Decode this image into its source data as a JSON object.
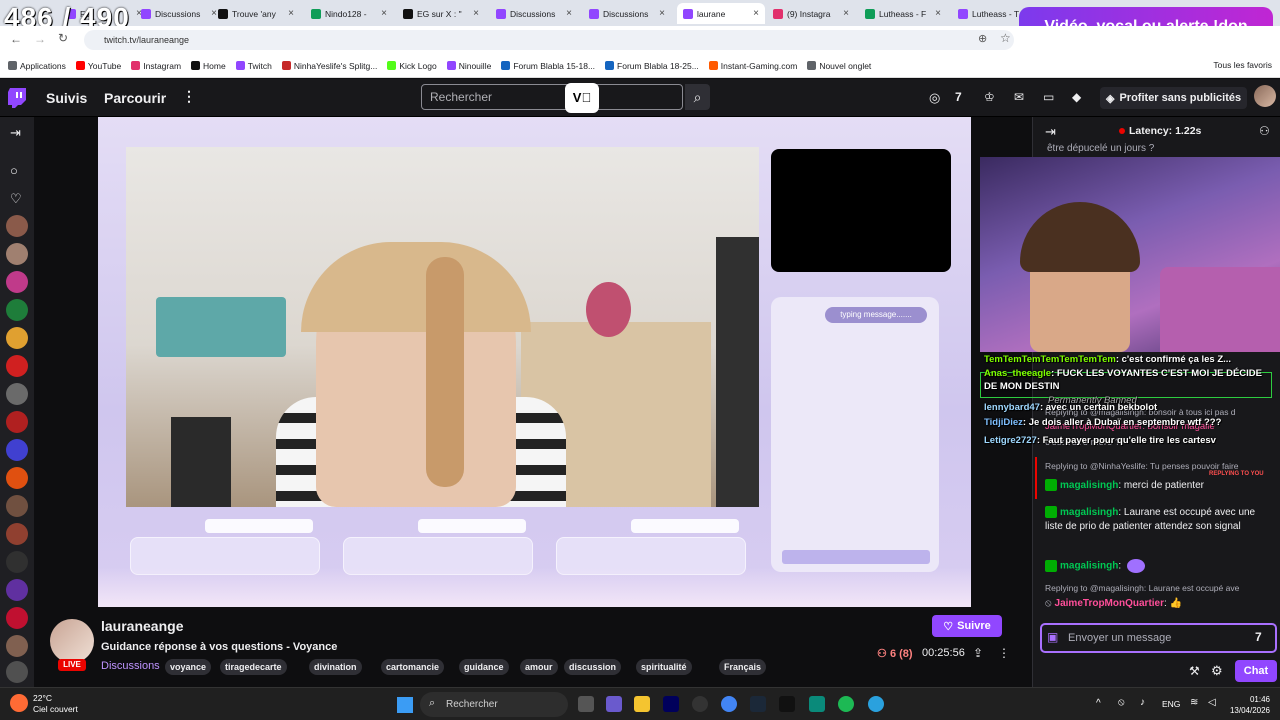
{
  "overlay_counter": "486 / 490",
  "browser": {
    "tabs": [
      {
        "label": "Fo",
        "color": "#9146ff",
        "active": false
      },
      {
        "label": "Discussions",
        "color": "#9146ff",
        "active": false
      },
      {
        "label": "Trouve 'any",
        "color": "#111111",
        "active": false
      },
      {
        "label": "Nindo128 -",
        "color": "#0f9d58",
        "active": false
      },
      {
        "label": "EG sur X : \"",
        "color": "#111111",
        "active": false
      },
      {
        "label": "Discussions",
        "color": "#9146ff",
        "active": false
      },
      {
        "label": "Discussions",
        "color": "#9146ff",
        "active": false
      },
      {
        "label": "laurane",
        "color": "#9146ff",
        "active": true
      },
      {
        "label": "(9) Instagra",
        "color": "#e1306c",
        "active": false
      },
      {
        "label": "Lutheass - F",
        "color": "#0f9d58",
        "active": false
      },
      {
        "label": "Lutheass - T",
        "color": "#9146ff",
        "active": false
      }
    ],
    "url": "twitch.tv/lauraneange",
    "bookmarks": [
      {
        "label": "Applications",
        "color": "#5f6368"
      },
      {
        "label": "YouTube",
        "color": "#ff0000"
      },
      {
        "label": "Instagram",
        "color": "#e1306c"
      },
      {
        "label": "Home",
        "color": "#111111"
      },
      {
        "label": "Twitch",
        "color": "#9146ff"
      },
      {
        "label": "NinhaYeslife's Splitg...",
        "color": "#c62828"
      },
      {
        "label": "Kick Logo",
        "color": "#53fc18"
      },
      {
        "label": "Ninouille",
        "color": "#9146ff"
      },
      {
        "label": "Forum Blabla 15-18...",
        "color": "#1565c0"
      },
      {
        "label": "Forum Blabla 18-25...",
        "color": "#1565c0"
      },
      {
        "label": "Instant-Gaming.com",
        "color": "#ff5a00"
      },
      {
        "label": "Nouvel onglet",
        "color": "#5f6368"
      }
    ],
    "all_bookmarks": "Tous les favoris",
    "donation_banner": "Vidéo, vocal ou alerte !don"
  },
  "twitch_nav": {
    "following": "Suivis",
    "browse": "Parcourir",
    "search_placeholder": "Rechercher",
    "ad_free": "Profiter sans publicités",
    "accent": "#9147ff"
  },
  "stream_overlay": {
    "typing": "typing message......."
  },
  "stream_info": {
    "channel": "lauraneange",
    "live": "LIVE",
    "title": "Guidance réponse à vos questions - Voyance",
    "category": "Discussions",
    "tags": [
      "voyance",
      "tiragedecarte",
      "divination",
      "cartomancie",
      "guidance",
      "amour",
      "discussion",
      "spiritualité",
      "Français"
    ],
    "follow": "Suivre",
    "viewers": "6 (8)",
    "uptime": "00:25:56"
  },
  "chat": {
    "latency": "Latency: 1.22s",
    "top_text": "être dépucelé un jours ?",
    "overlay_messages": [
      {
        "user": "TemTemTemTemTemTemTem",
        "text": ": c'est confirmé ça les Z..."
      },
      {
        "user": "Anas_theeagle",
        "text": ": FUCK LES VOYANTES C'EST MOI JE DÉCIDE"
      },
      {
        "user": "",
        "text": "DE MON DESTIN"
      },
      {
        "user": "",
        "text": "Permanently Banned"
      },
      {
        "user": "lennybard47",
        "text": ": avec un certain bekbolot"
      },
      {
        "user": "TidjiDiez",
        "text": ": Je dois aller à Dubaï en septembre wtf ???"
      },
      {
        "user": "Letigre2727",
        "text": ": Faut payer pour qu'elle tire les cartesv"
      }
    ],
    "reply1": "Replying to @magalisingh: bonsoir à tous ici pas d",
    "ghost1": "JaimeTropMonQuartier: bonsoir magalie",
    "ghost2": "c'est votre mère ?",
    "reply2": "Replying to @NinhaYeslife: Tu penses pouvoir faire",
    "reply2_tag": "REPLYING TO YOU",
    "messages": [
      {
        "user": "magalisingh",
        "text": ": merci de patienter",
        "color": "#00c853"
      },
      {
        "user": "magalisingh",
        "text": ": Laurane est occupé avec une liste de prio de patienter attendez son signal",
        "color": "#00c853"
      },
      {
        "user": "magalisingh",
        "text": ":",
        "color": "#00c853"
      }
    ],
    "reply3": "Replying to @magalisingh: Laurane est occupé ave",
    "last_user": "JaimeTropMonQuartier",
    "last_user_color": "#ff4f9a",
    "input_placeholder": "Envoyer un message",
    "chat_button": "Chat"
  },
  "taskbar": {
    "weather_temp": "22°C",
    "weather_desc": "Ciel couvert",
    "search": "Rechercher",
    "lang": "ENG",
    "time": "01:46",
    "date": "13/04/2026"
  }
}
